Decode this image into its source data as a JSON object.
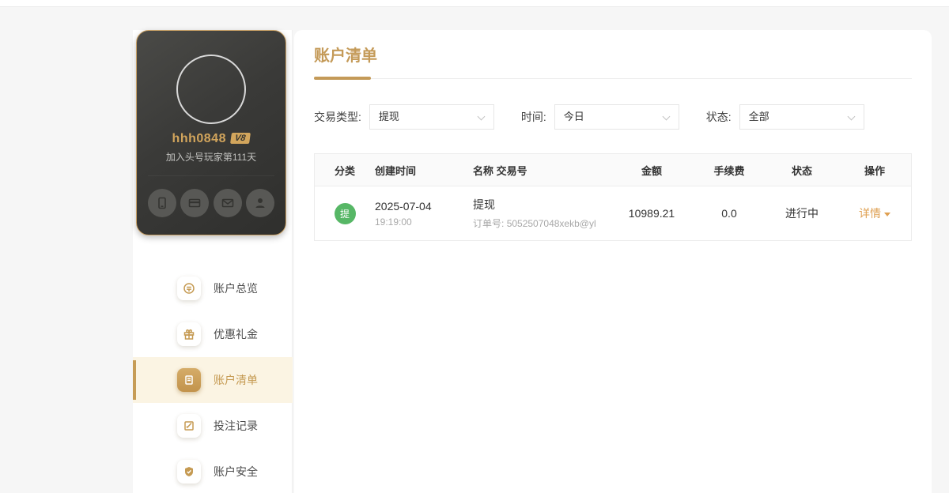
{
  "user_card": {
    "username": "hhh0848",
    "vip_badge": "V8",
    "join_text": "加入头号玩家第111天"
  },
  "sidebar": {
    "items": [
      {
        "label": "账户总览",
        "icon": "coin-icon"
      },
      {
        "label": "优惠礼金",
        "icon": "gift-icon"
      },
      {
        "label": "账户清单",
        "icon": "list-icon"
      },
      {
        "label": "投注记录",
        "icon": "record-icon"
      },
      {
        "label": "账户安全",
        "icon": "shield-icon"
      }
    ]
  },
  "main": {
    "title": "账户清单",
    "filters": [
      {
        "label": "交易类型:",
        "value": "提现"
      },
      {
        "label": "时间:",
        "value": "今日"
      },
      {
        "label": "状态:",
        "value": "全部"
      }
    ],
    "table": {
      "headers": [
        "分类",
        "创建时间",
        "名称 交易号",
        "金额",
        "手续费",
        "状态",
        "操作"
      ],
      "rows": [
        {
          "category_badge": "提",
          "created_date": "2025-07-04",
          "created_time": "19:19:00",
          "name": "提现",
          "order_label": "订单号:",
          "order_no": "5052507048xekb@yl",
          "amount": "10989.21",
          "fee": "0.0",
          "status": "进行中",
          "action": "详情"
        }
      ]
    }
  },
  "colors": {
    "accent_gold": "#c49a58",
    "active_bg": "#fbf4e3",
    "badge_green": "#57b766",
    "action_link": "#dfa052",
    "card_border": "#caa267"
  }
}
